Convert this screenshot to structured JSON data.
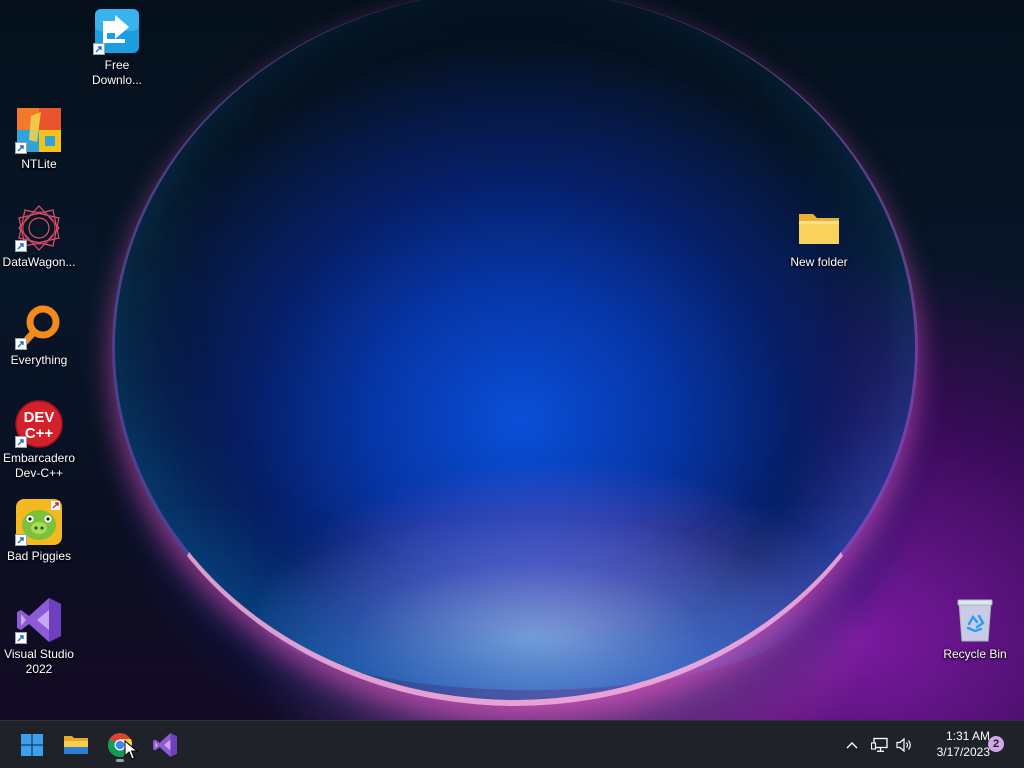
{
  "desktop": {
    "icons": [
      {
        "label": "Free\nDownlo...",
        "icon": "free-download-manager-icon"
      },
      {
        "label": "NTLite",
        "icon": "ntlite-icon"
      },
      {
        "label": "DataWagon...",
        "icon": "datawagon-icon"
      },
      {
        "label": "Everything",
        "icon": "everything-search-icon"
      },
      {
        "label": "Embarcadero\nDev-C++",
        "icon": "devcpp-icon"
      },
      {
        "label": "Bad Piggies",
        "icon": "bad-piggies-icon"
      },
      {
        "label": "Visual Studio\n2022",
        "icon": "visual-studio-icon"
      },
      {
        "label": "New folder",
        "icon": "folder-icon"
      },
      {
        "label": "Recycle Bin",
        "icon": "recycle-bin-icon"
      }
    ],
    "devcpp_text_top": "DEV",
    "devcpp_text_bottom": "C++"
  },
  "taskbar": {
    "apps": [
      "start-icon",
      "file-explorer-icon",
      "chrome-icon",
      "visual-studio-icon"
    ],
    "tray_icons": [
      "chevron-up-icon",
      "network-icon",
      "volume-icon"
    ],
    "time": "1:31 AM",
    "date": "3/17/2023",
    "notification_count": "2"
  },
  "colors": {
    "taskbar_bg": "#1f2228",
    "folder_yellow": "#f3c74a",
    "vs_purple": "#8d5bd6",
    "windows_blue": "#2a9df4"
  }
}
